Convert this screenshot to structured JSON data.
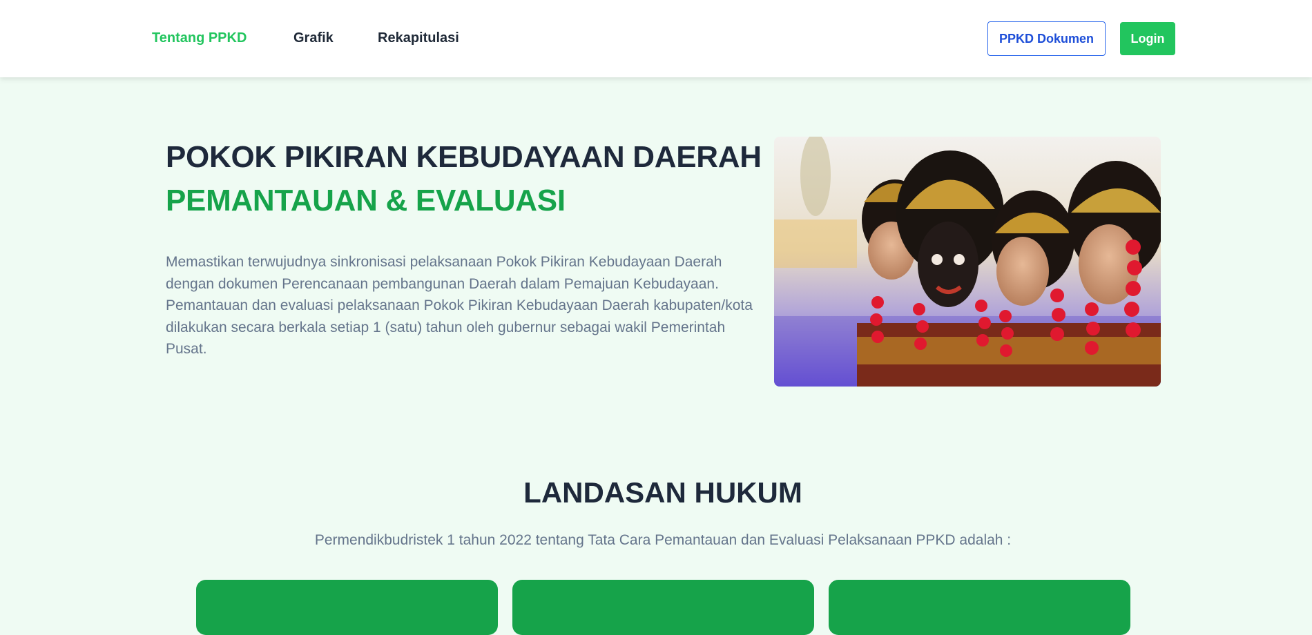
{
  "nav": {
    "links": [
      {
        "label": "Tentang PPKD",
        "active": true
      },
      {
        "label": "Grafik",
        "active": false
      },
      {
        "label": "Rekapitulasi",
        "active": false
      }
    ],
    "documents_button": "PPKD Dokumen",
    "login_button": "Login"
  },
  "hero": {
    "title_line1": "POKOK PIKIRAN KEBUDAYAAN DAERAH",
    "title_line2": "PEMANTAUAN & EVALUASI",
    "description": "Memastikan terwujudnya sinkronisasi pelaksanaan Pokok Pikiran Kebudayaan Daerah dengan dokumen Perencanaan pembangunan Daerah dalam Pemajuan Kebudayaan. Pemantauan dan evaluasi pelaksanaan Pokok Pikiran Kebudayaan Daerah kabupaten/kota dilakukan secara berkala setiap 1 (satu) tahun oleh gubernur sebagai wakil Pemerintah Pusat."
  },
  "landasan": {
    "title": "LANDASAN HUKUM",
    "subtitle": "Permendikbudristek 1 tahun 2022 tentang Tata Cara Pemantauan dan Evaluasi Pelaksanaan PPKD adalah :",
    "cards": [
      {
        "label": ""
      },
      {
        "label": ""
      },
      {
        "label": ""
      }
    ]
  },
  "colors": {
    "accent_green": "#22c55e",
    "dark_green": "#16a34a",
    "blue": "#2563eb",
    "background": "#effbf3"
  }
}
